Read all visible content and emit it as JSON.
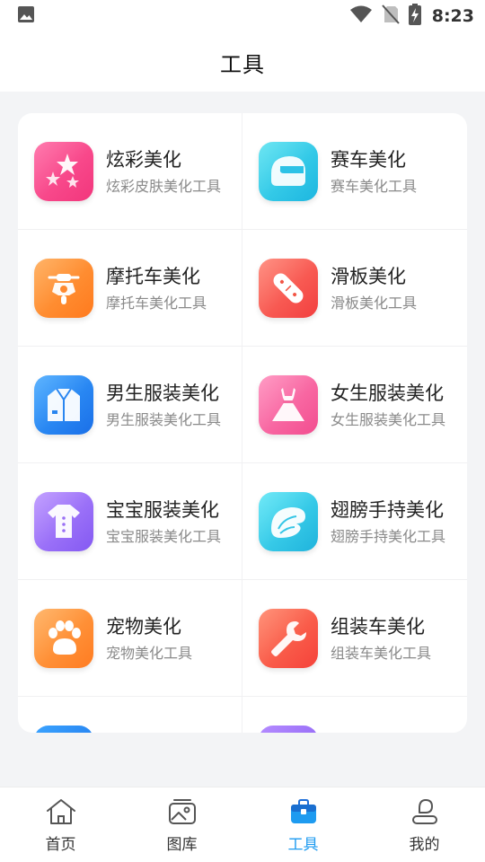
{
  "status_bar": {
    "time": "8:23",
    "icons": [
      "image-icon",
      "wifi-icon",
      "no-sim-icon",
      "battery-charging-icon"
    ]
  },
  "header": {
    "title": "工具"
  },
  "tools": [
    {
      "title": "炫彩美化",
      "subtitle": "炫彩皮肤美化工具",
      "icon": "stars-icon",
      "color": "#f2367c"
    },
    {
      "title": "赛车美化",
      "subtitle": "赛车美化工具",
      "icon": "racing-helmet-icon",
      "color": "#1db6e0"
    },
    {
      "title": "摩托车美化",
      "subtitle": "摩托车美化工具",
      "icon": "motorcycle-icon",
      "color": "#ff7a1e"
    },
    {
      "title": "滑板美化",
      "subtitle": "滑板美化工具",
      "icon": "skateboard-icon",
      "color": "#f23f3f"
    },
    {
      "title": "男生服装美化",
      "subtitle": "男生服装美化工具",
      "icon": "mens-jacket-icon",
      "color": "#1a6fe8"
    },
    {
      "title": "女生服装美化",
      "subtitle": "女生服装美化工具",
      "icon": "dress-icon",
      "color": "#f24d8f"
    },
    {
      "title": "宝宝服装美化",
      "subtitle": "宝宝服装美化工具",
      "icon": "baby-clothes-icon",
      "color": "#8459f2"
    },
    {
      "title": "翅膀手持美化",
      "subtitle": "翅膀手持美化工具",
      "icon": "wing-icon",
      "color": "#1fb3dc"
    },
    {
      "title": "宠物美化",
      "subtitle": "宠物美化工具",
      "icon": "paw-icon",
      "color": "#ff7c22"
    },
    {
      "title": "组装车美化",
      "subtitle": "组装车美化工具",
      "icon": "wrench-icon",
      "color": "#f5423a"
    }
  ],
  "bottom_nav": [
    {
      "label": "首页",
      "icon": "home-icon",
      "active": false
    },
    {
      "label": "图库",
      "icon": "gallery-icon",
      "active": false
    },
    {
      "label": "工具",
      "icon": "toolbox-icon",
      "active": true
    },
    {
      "label": "我的",
      "icon": "profile-icon",
      "active": false
    }
  ],
  "colors": {
    "accent": "#1e9bf0",
    "background": "#f3f4f6"
  }
}
